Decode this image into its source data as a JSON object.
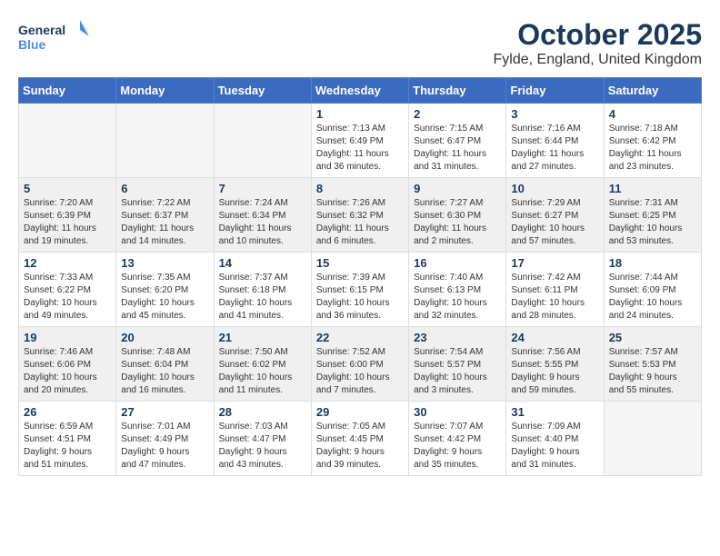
{
  "header": {
    "logo_line1": "General",
    "logo_line2": "Blue",
    "month": "October 2025",
    "location": "Fylde, England, United Kingdom"
  },
  "days_of_week": [
    "Sunday",
    "Monday",
    "Tuesday",
    "Wednesday",
    "Thursday",
    "Friday",
    "Saturday"
  ],
  "weeks": [
    [
      {
        "day": "",
        "info": ""
      },
      {
        "day": "",
        "info": ""
      },
      {
        "day": "",
        "info": ""
      },
      {
        "day": "1",
        "info": "Sunrise: 7:13 AM\nSunset: 6:49 PM\nDaylight: 11 hours\nand 36 minutes."
      },
      {
        "day": "2",
        "info": "Sunrise: 7:15 AM\nSunset: 6:47 PM\nDaylight: 11 hours\nand 31 minutes."
      },
      {
        "day": "3",
        "info": "Sunrise: 7:16 AM\nSunset: 6:44 PM\nDaylight: 11 hours\nand 27 minutes."
      },
      {
        "day": "4",
        "info": "Sunrise: 7:18 AM\nSunset: 6:42 PM\nDaylight: 11 hours\nand 23 minutes."
      }
    ],
    [
      {
        "day": "5",
        "info": "Sunrise: 7:20 AM\nSunset: 6:39 PM\nDaylight: 11 hours\nand 19 minutes."
      },
      {
        "day": "6",
        "info": "Sunrise: 7:22 AM\nSunset: 6:37 PM\nDaylight: 11 hours\nand 14 minutes."
      },
      {
        "day": "7",
        "info": "Sunrise: 7:24 AM\nSunset: 6:34 PM\nDaylight: 11 hours\nand 10 minutes."
      },
      {
        "day": "8",
        "info": "Sunrise: 7:26 AM\nSunset: 6:32 PM\nDaylight: 11 hours\nand 6 minutes."
      },
      {
        "day": "9",
        "info": "Sunrise: 7:27 AM\nSunset: 6:30 PM\nDaylight: 11 hours\nand 2 minutes."
      },
      {
        "day": "10",
        "info": "Sunrise: 7:29 AM\nSunset: 6:27 PM\nDaylight: 10 hours\nand 57 minutes."
      },
      {
        "day": "11",
        "info": "Sunrise: 7:31 AM\nSunset: 6:25 PM\nDaylight: 10 hours\nand 53 minutes."
      }
    ],
    [
      {
        "day": "12",
        "info": "Sunrise: 7:33 AM\nSunset: 6:22 PM\nDaylight: 10 hours\nand 49 minutes."
      },
      {
        "day": "13",
        "info": "Sunrise: 7:35 AM\nSunset: 6:20 PM\nDaylight: 10 hours\nand 45 minutes."
      },
      {
        "day": "14",
        "info": "Sunrise: 7:37 AM\nSunset: 6:18 PM\nDaylight: 10 hours\nand 41 minutes."
      },
      {
        "day": "15",
        "info": "Sunrise: 7:39 AM\nSunset: 6:15 PM\nDaylight: 10 hours\nand 36 minutes."
      },
      {
        "day": "16",
        "info": "Sunrise: 7:40 AM\nSunset: 6:13 PM\nDaylight: 10 hours\nand 32 minutes."
      },
      {
        "day": "17",
        "info": "Sunrise: 7:42 AM\nSunset: 6:11 PM\nDaylight: 10 hours\nand 28 minutes."
      },
      {
        "day": "18",
        "info": "Sunrise: 7:44 AM\nSunset: 6:09 PM\nDaylight: 10 hours\nand 24 minutes."
      }
    ],
    [
      {
        "day": "19",
        "info": "Sunrise: 7:46 AM\nSunset: 6:06 PM\nDaylight: 10 hours\nand 20 minutes."
      },
      {
        "day": "20",
        "info": "Sunrise: 7:48 AM\nSunset: 6:04 PM\nDaylight: 10 hours\nand 16 minutes."
      },
      {
        "day": "21",
        "info": "Sunrise: 7:50 AM\nSunset: 6:02 PM\nDaylight: 10 hours\nand 11 minutes."
      },
      {
        "day": "22",
        "info": "Sunrise: 7:52 AM\nSunset: 6:00 PM\nDaylight: 10 hours\nand 7 minutes."
      },
      {
        "day": "23",
        "info": "Sunrise: 7:54 AM\nSunset: 5:57 PM\nDaylight: 10 hours\nand 3 minutes."
      },
      {
        "day": "24",
        "info": "Sunrise: 7:56 AM\nSunset: 5:55 PM\nDaylight: 9 hours\nand 59 minutes."
      },
      {
        "day": "25",
        "info": "Sunrise: 7:57 AM\nSunset: 5:53 PM\nDaylight: 9 hours\nand 55 minutes."
      }
    ],
    [
      {
        "day": "26",
        "info": "Sunrise: 6:59 AM\nSunset: 4:51 PM\nDaylight: 9 hours\nand 51 minutes."
      },
      {
        "day": "27",
        "info": "Sunrise: 7:01 AM\nSunset: 4:49 PM\nDaylight: 9 hours\nand 47 minutes."
      },
      {
        "day": "28",
        "info": "Sunrise: 7:03 AM\nSunset: 4:47 PM\nDaylight: 9 hours\nand 43 minutes."
      },
      {
        "day": "29",
        "info": "Sunrise: 7:05 AM\nSunset: 4:45 PM\nDaylight: 9 hours\nand 39 minutes."
      },
      {
        "day": "30",
        "info": "Sunrise: 7:07 AM\nSunset: 4:42 PM\nDaylight: 9 hours\nand 35 minutes."
      },
      {
        "day": "31",
        "info": "Sunrise: 7:09 AM\nSunset: 4:40 PM\nDaylight: 9 hours\nand 31 minutes."
      },
      {
        "day": "",
        "info": ""
      }
    ]
  ]
}
